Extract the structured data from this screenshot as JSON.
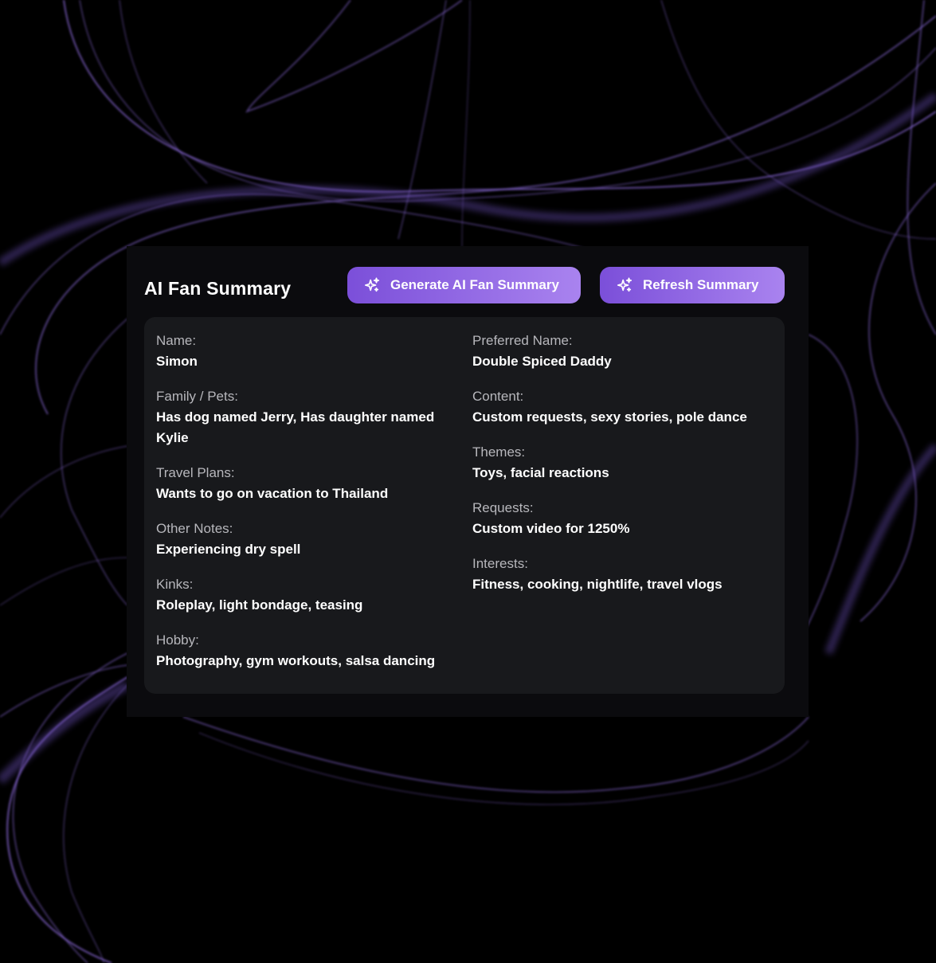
{
  "header": {
    "title": "AI Fan Summary"
  },
  "buttons": {
    "generate": {
      "label": "Generate AI Fan Summary",
      "icon": "sparkles-icon"
    },
    "refresh": {
      "label": "Refresh Summary",
      "icon": "sparkles-icon"
    }
  },
  "summary": {
    "left": [
      {
        "label": "Name:",
        "value": "Simon"
      },
      {
        "label": "Family / Pets:",
        "value": "Has dog named Jerry, Has daughter named Kylie"
      },
      {
        "label": "Travel Plans:",
        "value": "Wants to go on vacation to Thailand"
      },
      {
        "label": "Other Notes:",
        "value": "Experiencing dry spell"
      },
      {
        "label": "Kinks:",
        "value": "Roleplay, light bondage, teasing"
      },
      {
        "label": "Hobby:",
        "value": "Photography, gym workouts, salsa dancing"
      }
    ],
    "right": [
      {
        "label": "Preferred Name:",
        "value": "Double Spiced Daddy"
      },
      {
        "label": "Content:",
        "value": "Custom requests, sexy stories, pole dance"
      },
      {
        "label": "Themes:",
        "value": "Toys, facial reactions"
      },
      {
        "label": "Requests:",
        "value": "Custom video for 1250%"
      },
      {
        "label": "Interests:",
        "value": "Fitness, cooking, nightlife, travel vlogs"
      }
    ]
  },
  "colors": {
    "accent_start": "#7b4fd9",
    "accent_end": "#a983ef",
    "smoke": "#8a6ad8"
  }
}
